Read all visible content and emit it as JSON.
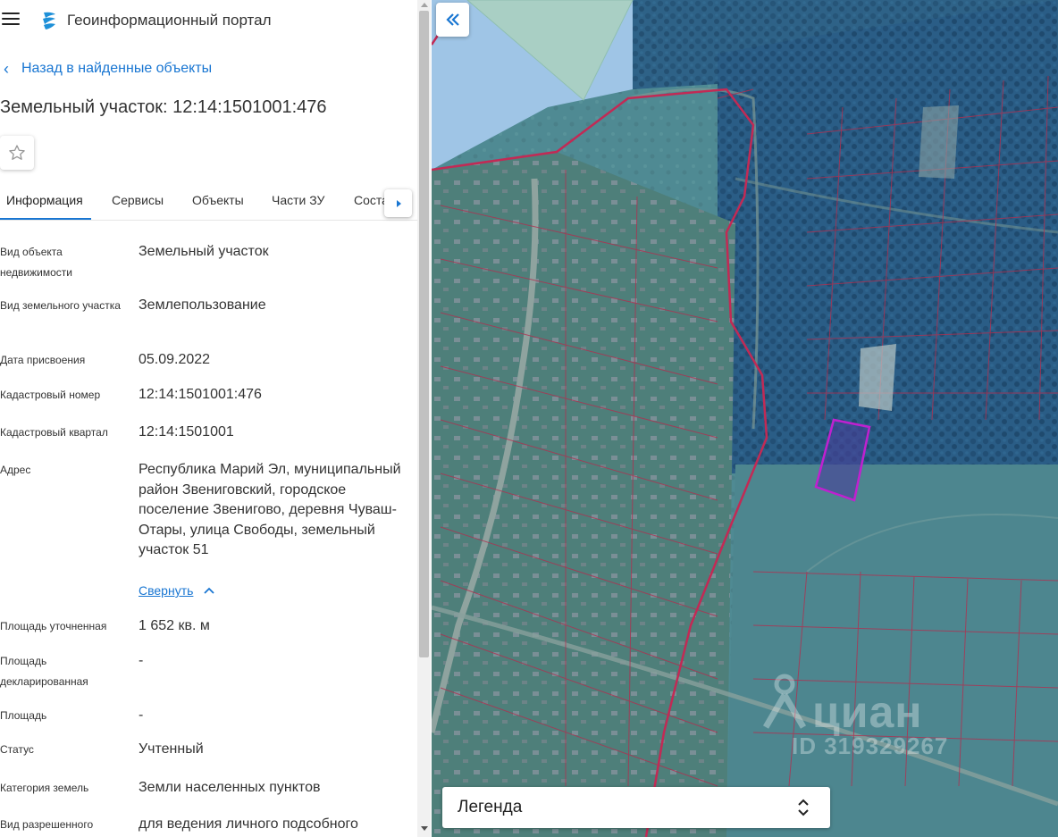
{
  "header": {
    "app_title": "Геоинформационный портал"
  },
  "nav": {
    "back_label": "Назад в найденные объекты"
  },
  "object": {
    "title": "Земельный участок: 12:14:1501001:476"
  },
  "tabs": [
    {
      "label": "Информация",
      "active": true
    },
    {
      "label": "Сервисы"
    },
    {
      "label": "Объекты"
    },
    {
      "label": "Части ЗУ"
    },
    {
      "label": "Состав"
    }
  ],
  "fields": [
    {
      "label": "Вид объекта недвижимости",
      "value": "Земельный участок"
    },
    {
      "label": "Вид земельного участка",
      "value": "Землепользование"
    },
    {
      "label": "Дата присвоения",
      "value": "05.09.2022"
    },
    {
      "label": "Кадастровый номер",
      "value": "12:14:1501001:476"
    },
    {
      "label": "Кадастровый квартал",
      "value": "12:14:1501001"
    },
    {
      "label": "Адрес",
      "value": "Республика Марий Эл, муниципальный район Звениговский, городское поселение Звенигово, деревня Чуваш-Отары, улица Свободы, земельный участок 51"
    },
    {
      "label": "Площадь уточненная",
      "value": "1 652 кв. м"
    },
    {
      "label": "Площадь декларированная",
      "value": "-"
    },
    {
      "label": "Площадь",
      "value": "-"
    },
    {
      "label": "Статус",
      "value": "Учтенный"
    },
    {
      "label": "Категория земель",
      "value": "Земли населенных пунктов"
    },
    {
      "label": "Вид разрешенного",
      "value": "для ведения личного подсобного"
    }
  ],
  "address_toggle": {
    "label": "Свернуть"
  },
  "map": {
    "legend_label": "Легенда",
    "watermark_brand": "циан",
    "watermark_id": "ID 319329267",
    "colors": {
      "parcel_border": "#b03050",
      "selected_parcel": "#c020d0",
      "overlay": "#2a5aa8"
    }
  },
  "colors": {
    "accent": "#1976d2"
  }
}
